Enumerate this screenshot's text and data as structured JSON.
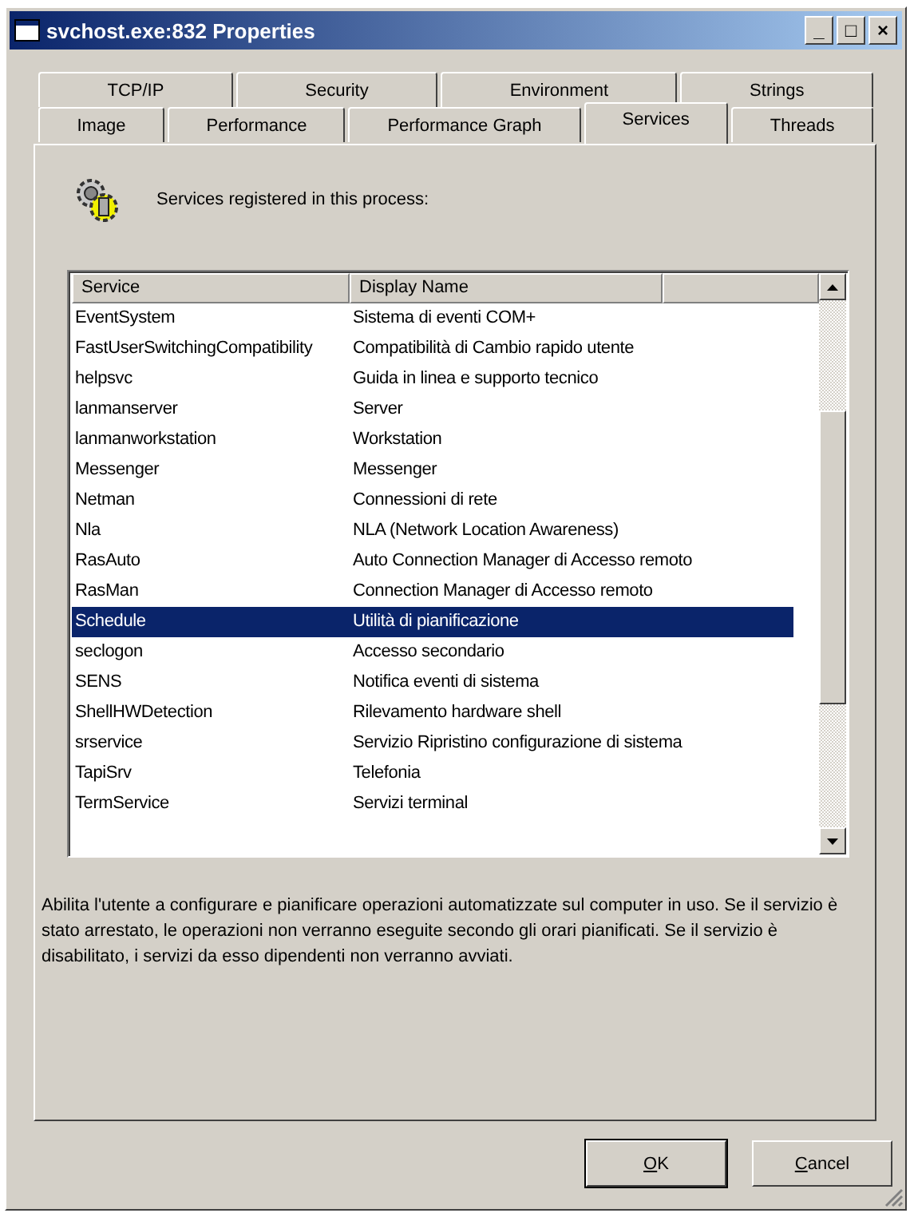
{
  "window": {
    "title": "svchost.exe:832 Properties",
    "controls": [
      "_",
      "□",
      "×"
    ]
  },
  "tab_rows": [
    {
      "tabs": [
        {
          "label": "TCP/IP",
          "selected": false
        },
        {
          "label": "Security",
          "selected": false
        },
        {
          "label": "Environment",
          "selected": false
        },
        {
          "label": "Strings",
          "selected": false
        }
      ]
    },
    {
      "tabs": [
        {
          "label": "Image",
          "selected": false
        },
        {
          "label": "Performance",
          "selected": false
        },
        {
          "label": "Performance Graph",
          "selected": false
        },
        {
          "label": "Services",
          "selected": true
        },
        {
          "label": "Threads",
          "selected": false
        }
      ]
    }
  ],
  "heading": "Services registered in this process:",
  "table": {
    "columns": [
      "Service",
      "Display Name"
    ],
    "rows": [
      {
        "cells": [
          "EventSystem",
          "Sistema di eventi COM+"
        ],
        "selected": false
      },
      {
        "cells": [
          "FastUserSwitchingCompatibility",
          "Compatibilità di Cambio rapido utente"
        ],
        "selected": false
      },
      {
        "cells": [
          "helpsvc",
          "Guida in linea e supporto tecnico"
        ],
        "selected": false
      },
      {
        "cells": [
          "lanmanserver",
          "Server"
        ],
        "selected": false
      },
      {
        "cells": [
          "lanmanworkstation",
          "Workstation"
        ],
        "selected": false
      },
      {
        "cells": [
          "Messenger",
          "Messenger"
        ],
        "selected": false
      },
      {
        "cells": [
          "Netman",
          "Connessioni di rete"
        ],
        "selected": false
      },
      {
        "cells": [
          "Nla",
          "NLA (Network Location Awareness)"
        ],
        "selected": false
      },
      {
        "cells": [
          "RasAuto",
          "Auto Connection Manager di Accesso remoto"
        ],
        "selected": false
      },
      {
        "cells": [
          "RasMan",
          "Connection Manager di Accesso remoto"
        ],
        "selected": false
      },
      {
        "cells": [
          "Schedule",
          "Utilità di pianificazione"
        ],
        "selected": true
      },
      {
        "cells": [
          "seclogon",
          "Accesso secondario"
        ],
        "selected": false
      },
      {
        "cells": [
          "SENS",
          "Notifica eventi di sistema"
        ],
        "selected": false
      },
      {
        "cells": [
          "ShellHWDetection",
          "Rilevamento hardware shell"
        ],
        "selected": false
      },
      {
        "cells": [
          "srservice",
          "Servizio Ripristino configurazione di sistema"
        ],
        "selected": false
      },
      {
        "cells": [
          "TapiSrv",
          "Telefonia"
        ],
        "selected": false
      },
      {
        "cells": [
          "TermService",
          "Servizi terminal"
        ],
        "selected": false
      }
    ]
  },
  "description": "Abilita l'utente a configurare e pianificare operazioni automatizzate sul computer in uso. Se il servizio è stato arrestato, le operazioni non verranno eseguite secondo gli orari pianificati. Se il servizio è disabilitato, i servizi da esso dipendenti non verranno avviati.",
  "buttons": [
    "OK",
    "Cancel"
  ]
}
